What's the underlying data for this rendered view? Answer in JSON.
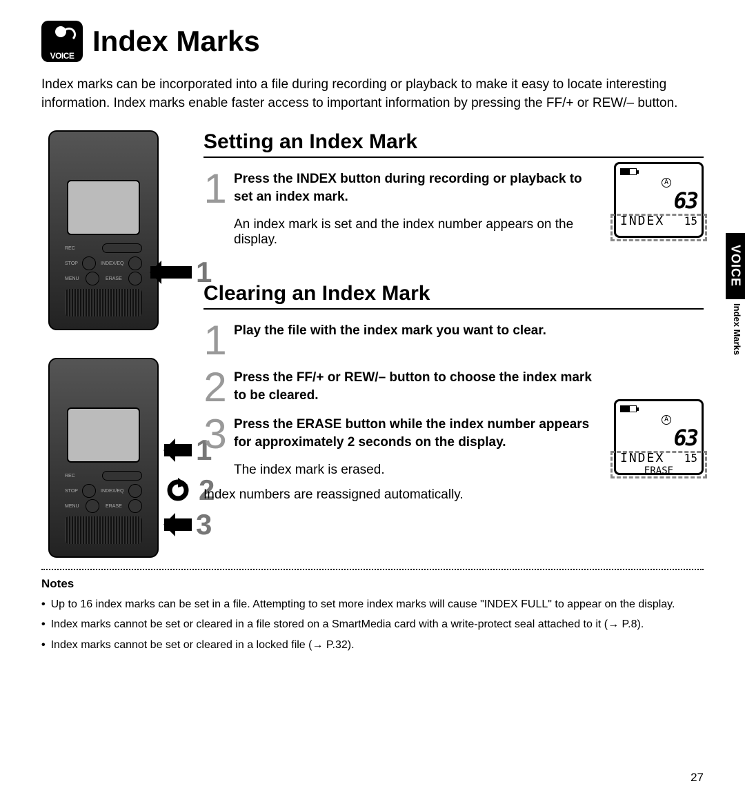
{
  "voice_label": "VOICE",
  "page_title": "Index Marks",
  "intro": "Index marks can be incorporated into a file during recording or playback to make it easy to locate interesting information. Index marks enable faster access to important information by pressing the FF/+ or REW/– button.",
  "section1": {
    "title": "Setting an Index Mark",
    "step_num": "1",
    "step_bold": "Press the INDEX button during recording or playback to set an index mark.",
    "step_note": "An index mark is set and the index number appears on the display."
  },
  "section2": {
    "title": "Clearing an Index Mark",
    "steps": [
      {
        "num": "1",
        "bold": "Play the file with the index mark you want to clear."
      },
      {
        "num": "2",
        "bold": "Press the FF/+ or REW/– button to choose the index mark to be cleared."
      },
      {
        "num": "3",
        "bold": "Press the ERASE button while the index number appears for approximately 2 seconds on the display.",
        "note": "The index mark is erased."
      }
    ],
    "tail": "Index numbers are reassigned automatically."
  },
  "lcd1": {
    "circled": "A",
    "big": "63",
    "word": "INDEX",
    "small": "15"
  },
  "lcd2": {
    "circled": "A",
    "big": "63",
    "word": "INDEX",
    "small": "15",
    "sub": "ERASE"
  },
  "notes_title": "Notes",
  "notes": [
    "Up to 16 index marks can be set in a file. Attempting to set more index marks will cause \"INDEX FULL\" to appear on the display.",
    "Index marks cannot be set or cleared in a file stored on a SmartMedia card with a write-protect seal attached to it (→ P.8).",
    "Index marks cannot be set or cleared in a locked file (→ P.32)."
  ],
  "page_number": "27",
  "side_tab": "VOICE",
  "side_sub": "Index Marks",
  "device_labels": {
    "rec": "REC",
    "stop": "STOP",
    "index": "INDEX/EQ",
    "menu": "MENU",
    "erase": "ERASE"
  },
  "callouts": {
    "c1": "1",
    "c2": "2",
    "c3": "3"
  }
}
